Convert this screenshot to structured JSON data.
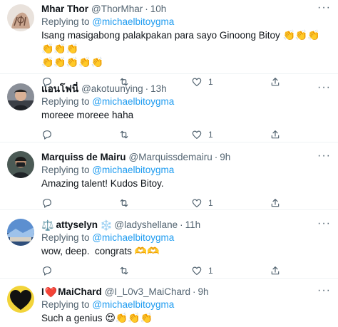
{
  "tweets": [
    {
      "name": "Mhar Thor",
      "handle": "@ThorMhar",
      "time": "10h",
      "reply_prefix": "Replying to",
      "reply_to": "@michaelbitoygma",
      "text": "Isang masigabong palakpakan para sayo Ginoong Bitoy",
      "emoji_line1": "👏👏👏👏👏👏",
      "emoji_line2": "👏👏👏👏👏",
      "likes": "1"
    },
    {
      "name": "แอนโฟนี่",
      "handle": "@akotuunying",
      "time": "13h",
      "reply_prefix": "Replying to",
      "reply_to": "@michaelbitoygma",
      "text": "moreee moreee haha",
      "likes": "1"
    },
    {
      "name": "Marquiss de Mairu",
      "handle": "@Marquissdemairu",
      "time": "9h",
      "reply_prefix": "Replying to",
      "reply_to": "@michaelbitoygma",
      "text": "Amazing talent! Kudos Bitoy.",
      "likes": "1"
    },
    {
      "name": "attyselyn",
      "name_prefix_emoji": "⚖️",
      "name_suffix_emoji": "❄️",
      "handle": "@ladyshellane",
      "time": "11h",
      "reply_prefix": "Replying to",
      "reply_to": "@michaelbitoygma",
      "text": "wow, deep.  congrats",
      "emoji": "🫶🫶",
      "likes": "1"
    },
    {
      "name_prefix": "I",
      "name_heart": "❤️",
      "name": "MaiChard",
      "handle": "@I_L0v3_MaiChard",
      "time": "9h",
      "reply_prefix": "Replying to",
      "reply_to": "@michaelbitoygma",
      "text": "Such a genius",
      "emoji": "😍👏👏👏"
    }
  ],
  "dot": "·",
  "more": "···",
  "colors": {
    "link": "#1d9bf0",
    "muted": "#536471",
    "divider": "#eff3f4"
  },
  "icons": [
    "reply-icon",
    "retweet-icon",
    "like-icon",
    "share-icon",
    "more-icon"
  ]
}
